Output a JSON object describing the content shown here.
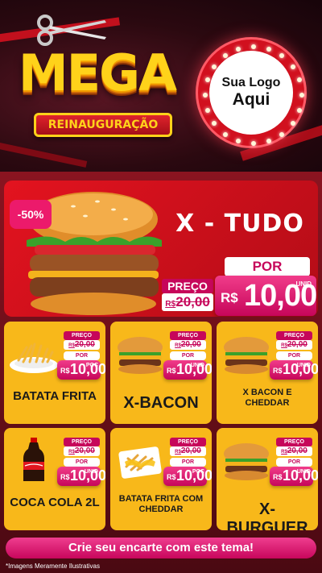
{
  "header": {
    "title": "MEGA",
    "subtitle": "REINAUGURAÇÃO",
    "logo_line1": "Sua Logo",
    "logo_line2": "Aqui"
  },
  "featured": {
    "discount": "-50%",
    "name": "X - TUDO",
    "price_label": "PREÇO",
    "old_price": "20,00",
    "currency": "R$",
    "por_label": "POR",
    "new_price": "10,00",
    "unit": "UNID"
  },
  "labels": {
    "price": "PREÇO",
    "por": "POR",
    "currency": "R$"
  },
  "products": [
    {
      "name": "BATATA FRITA",
      "old_price": "20,00",
      "new_price": "10,00",
      "unit": "POÇ",
      "icon": "fries-icon"
    },
    {
      "name": "X-BACON",
      "old_price": "20,00",
      "new_price": "10,00",
      "unit": "UNID",
      "icon": "burger-icon"
    },
    {
      "name": "X BACON E CHEDDAR",
      "old_price": "20,00",
      "new_price": "10,00",
      "unit": "UNID",
      "icon": "burger-icon"
    },
    {
      "name": "COCA COLA 2L",
      "old_price": "20,00",
      "new_price": "10,00",
      "unit": "UNID",
      "icon": "soda-bottle-icon"
    },
    {
      "name": "BATATA FRITA COM CHEDDAR",
      "old_price": "20,00",
      "new_price": "10,00",
      "unit": "POÇ",
      "icon": "fries-cheddar-icon"
    },
    {
      "name": "X-BURGUER",
      "old_price": "20,00",
      "new_price": "10,00",
      "unit": "UNID",
      "icon": "burger-icon"
    }
  ],
  "cta": "Crie seu encarte com este tema!",
  "disclaimer": "*Imagens Meramente Ilustrativas",
  "colors": {
    "accent_red": "#e3131f",
    "magenta": "#c6065a",
    "card_yellow": "#f8b81a",
    "title_yellow": "#ffd21a"
  }
}
